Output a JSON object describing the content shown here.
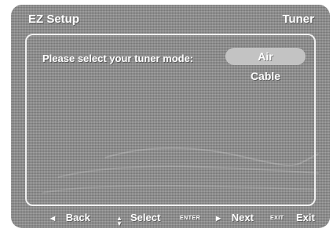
{
  "header": {
    "title": "EZ Setup",
    "section": "Tuner"
  },
  "prompt": "Please select your tuner mode:",
  "options": [
    {
      "label": "Air",
      "selected": true
    },
    {
      "label": "Cable",
      "selected": false
    }
  ],
  "footer": {
    "back_label": "Back",
    "select_label": "Select",
    "enter_key": "ENTER",
    "next_label": "Next",
    "exit_key": "EXIT",
    "exit_label": "Exit"
  },
  "colors": {
    "background": "#8f8f8f",
    "highlight": "#c3c3c3",
    "text": "#ffffff"
  },
  "icons": {
    "back": "triangle-left-icon",
    "select": "up-down-arrows-icon",
    "next": "triangle-right-icon"
  }
}
